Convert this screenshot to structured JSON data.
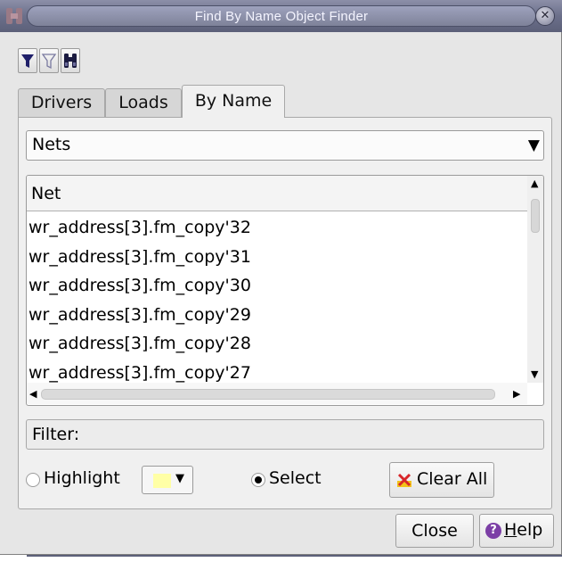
{
  "window": {
    "title": "Find By Name Object Finder",
    "close_glyph": "✕"
  },
  "toolbar": {
    "buttons": [
      {
        "icon": "filter-filled-icon"
      },
      {
        "icon": "filter-outline-icon"
      },
      {
        "icon": "binoculars-icon"
      }
    ]
  },
  "tabs": [
    {
      "label": "Drivers",
      "active": false
    },
    {
      "label": "Loads",
      "active": false
    },
    {
      "label": "By Name",
      "active": true
    }
  ],
  "object_type": {
    "selected": "Nets",
    "arrow": "▼"
  },
  "list": {
    "column_header": "Net",
    "rows": [
      "wr_address[3].fm_copy'32",
      "wr_address[3].fm_copy'31",
      "wr_address[3].fm_copy'30",
      "wr_address[3].fm_copy'29",
      "wr_address[3].fm_copy'28",
      "wr_address[3].fm_copy'27"
    ]
  },
  "filter": {
    "label": "Filter:"
  },
  "options": {
    "highlight_label": "Highlight",
    "select_label": "Select",
    "selected_mode": "Select",
    "highlight_color": "#ffffa6",
    "clear_all_label": "Clear All"
  },
  "footer": {
    "close_label": "Close",
    "help_prefix": "H",
    "help_rest": "elp",
    "help_glyph": "?"
  },
  "colors": {
    "title_bar": "#6b6f8a",
    "dialog_bg": "#e6e6e6",
    "help_icon": "#7c3fa6"
  }
}
